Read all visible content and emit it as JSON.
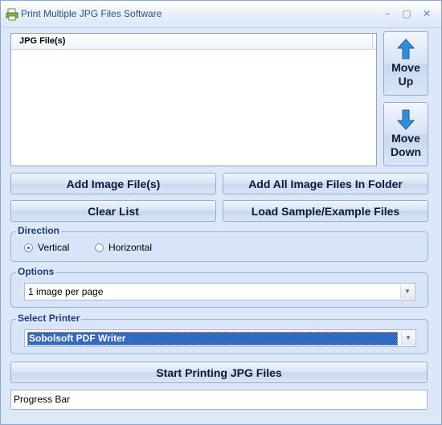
{
  "window": {
    "title": "Print Multiple JPG Files Software"
  },
  "file_list": {
    "column_header": "JPG File(s)",
    "items": []
  },
  "buttons": {
    "move_up": [
      "Move",
      "Up"
    ],
    "move_down": [
      "Move",
      "Down"
    ],
    "add_image_files": "Add Image File(s)",
    "add_all_in_folder": "Add All Image Files In Folder",
    "clear_list": "Clear List",
    "load_sample": "Load Sample/Example Files",
    "start_printing": "Start Printing JPG Files"
  },
  "direction": {
    "label": "Direction",
    "options": [
      "Vertical",
      "Horizontal"
    ],
    "selected": "Vertical"
  },
  "options": {
    "label": "Options",
    "selected": "1 image per page"
  },
  "printer": {
    "label": "Select Printer",
    "selected": "Sobolsoft PDF Writer"
  },
  "progress": {
    "text": "Progress Bar"
  },
  "colors": {
    "accent_blue": "#2e8fd8",
    "selection": "#316ac5",
    "background": "#dce7f8"
  }
}
